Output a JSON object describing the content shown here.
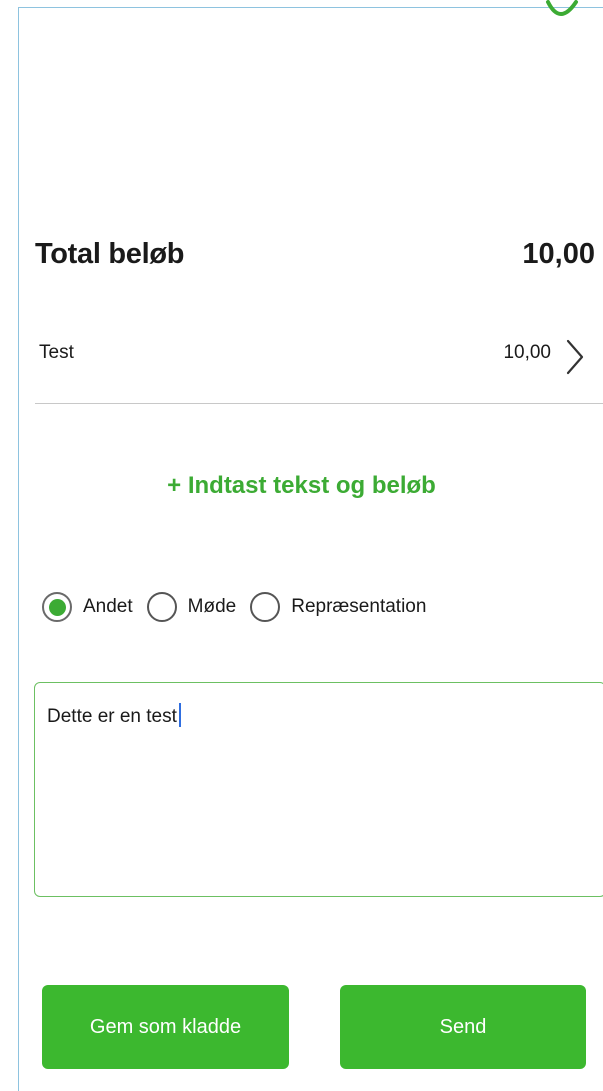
{
  "colors": {
    "accent": "#3cab34",
    "button_bg": "#3cb82f",
    "caret": "#2f6ee0",
    "frame_border": "#8ec3df"
  },
  "status": {
    "icon": "check-icon"
  },
  "total": {
    "label": "Total beløb",
    "value": "10,00"
  },
  "line_items": [
    {
      "name": "Test",
      "amount": "10,00",
      "icon": "chevron-right-icon"
    }
  ],
  "add_entry": {
    "label": "+ Indtast tekst og beløb"
  },
  "category": {
    "selected": "Andet",
    "options": [
      {
        "label": "Andet",
        "checked": true
      },
      {
        "label": "Møde",
        "checked": false
      },
      {
        "label": "Repræsentation",
        "checked": false
      }
    ]
  },
  "note": {
    "value": "Dette er en test"
  },
  "actions": {
    "save_draft_label": "Gem som kladde",
    "send_label": "Send"
  }
}
